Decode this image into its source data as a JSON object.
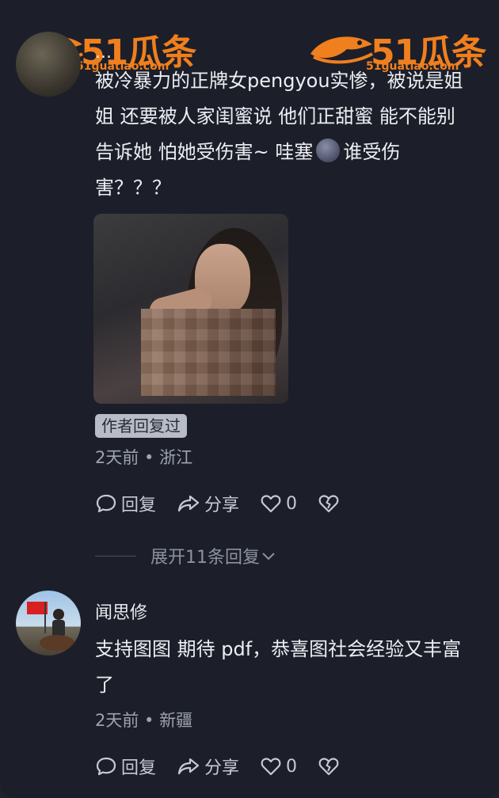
{
  "watermark": {
    "brand": "51瓜条",
    "url": "51guatiao.com"
  },
  "comments": [
    {
      "username": "...",
      "text_line1": "被冷暴力的正牌女pengyou实惨，被说是姐",
      "text_line2": "姐 还要被人家闺蜜说 他们正甜蜜 能不能别",
      "text_line3_a": "告诉她  怕她受伤害~  哇塞",
      "text_line3_b": "谁受伤",
      "text_line4": "害？？？",
      "badge": "作者回复过",
      "meta": "2天前 • 浙江",
      "reply_label": "回复",
      "share_label": "分享",
      "like_count": "0"
    },
    {
      "username": "闻思修",
      "text_line1": "支持图图 期待 pdf，恭喜图社会经验又丰富",
      "text_line2": "了",
      "meta": "2天前 • 新疆",
      "reply_label": "回复",
      "share_label": "分享",
      "like_count": "0"
    }
  ],
  "expand_replies": "展开11条回复",
  "icons": {
    "reply": "speech-bubble-icon",
    "share": "share-arrow-icon",
    "like": "heart-icon",
    "dislike": "broken-heart-icon",
    "expand": "chevron-down-icon",
    "emoji": "new-moon-face-emoji"
  },
  "colors": {
    "background": "#1c1f29",
    "accent": "#f07f1e",
    "badge": "#b8bcc8"
  }
}
